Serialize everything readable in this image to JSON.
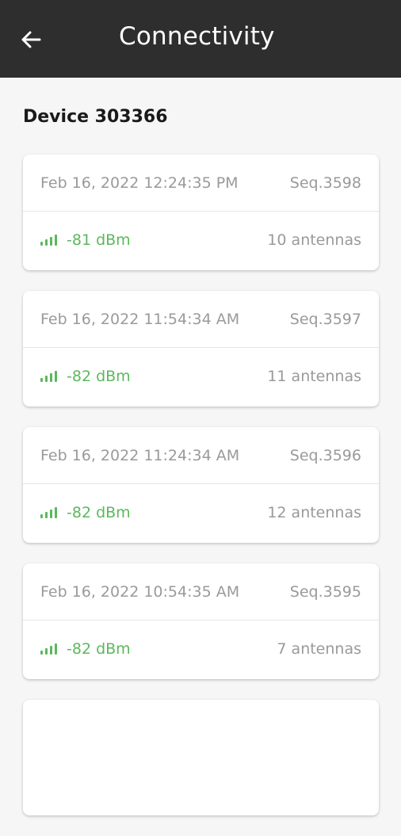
{
  "header": {
    "title": "Connectivity",
    "back_icon": "arrow-left-icon"
  },
  "device": {
    "title": "Device 303366"
  },
  "colors": {
    "app_bar": "#2e2e2e",
    "signal_green": "#5cb85c",
    "muted_text": "#9a9a9a"
  },
  "records": [
    {
      "timestamp": "Feb 16, 2022 12:24:35 PM",
      "seq": "Seq.3598",
      "signal": "-81 dBm",
      "antennas": "10 antennas"
    },
    {
      "timestamp": "Feb 16, 2022 11:54:34 AM",
      "seq": "Seq.3597",
      "signal": "-82 dBm",
      "antennas": "11 antennas"
    },
    {
      "timestamp": "Feb 16, 2022 11:24:34 AM",
      "seq": "Seq.3596",
      "signal": "-82 dBm",
      "antennas": "12 antennas"
    },
    {
      "timestamp": "Feb 16, 2022 10:54:35 AM",
      "seq": "Seq.3595",
      "signal": "-82 dBm",
      "antennas": "7 antennas"
    }
  ]
}
